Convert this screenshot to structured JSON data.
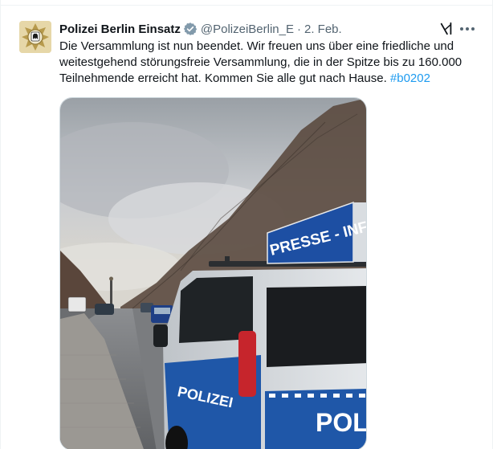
{
  "tweet": {
    "display_name": "Polizei Berlin Einsatz",
    "handle": "@PolizeiBerlin_E",
    "separator": "·",
    "date": "2. Feb.",
    "text_lines": [
      "Die Versammlung ist nun beendet. Wir freuen uns über eine friedliche und",
      "weitestgehend störungsfreie Versammlung, die in der Spitze bis zu 160.000",
      "Teilnehmende erreicht hat. Kommen Sie alle gut nach Hause. "
    ],
    "hashtag": "#b0202",
    "icons": {
      "avatar": "berlin-bear-police-star-icon",
      "verified": "verified-badge-icon",
      "grok": "grok-icon",
      "more": "more-options-icon"
    }
  },
  "media": {
    "van_sign_text": "PRESSE - INFO",
    "van_side_text_1": "POLIZEI",
    "van_rear_text": "POL"
  },
  "colors": {
    "accent": "#1d9bf0",
    "text": "#0f1419",
    "secondary": "#536471",
    "verified_gray": "#829aab"
  }
}
